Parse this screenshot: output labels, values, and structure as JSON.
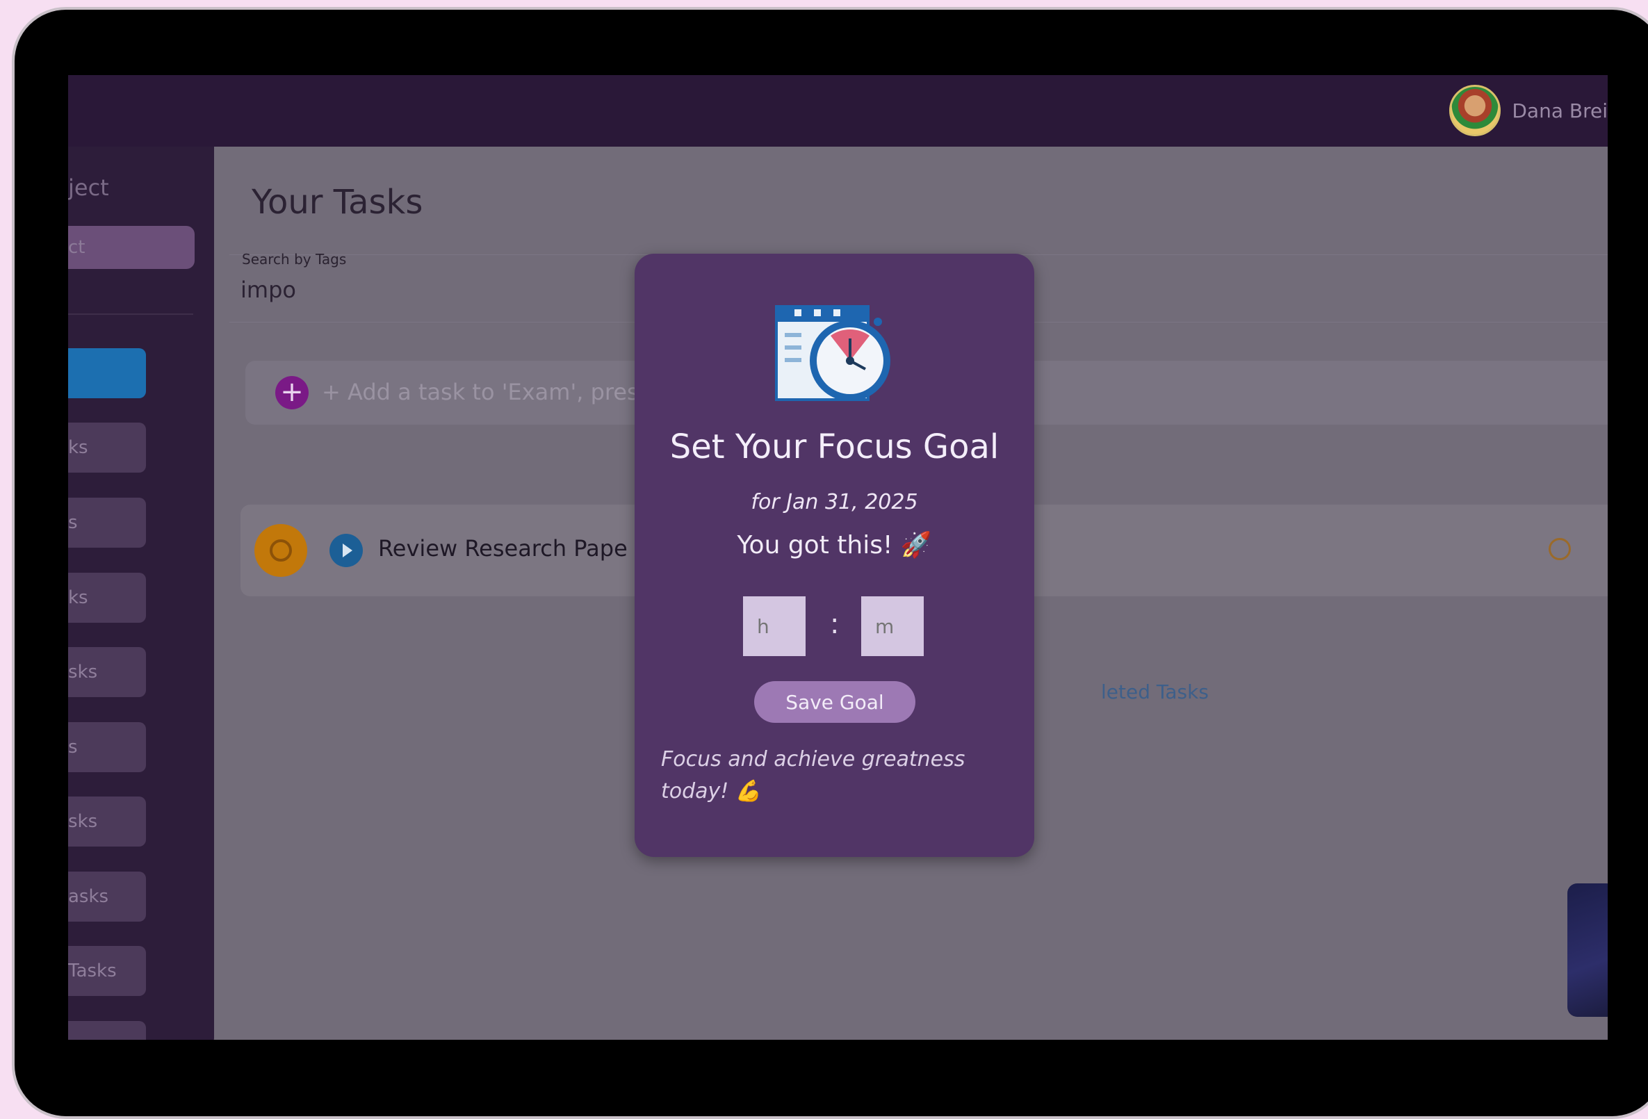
{
  "topbar": {
    "user_name": "Dana Brei",
    "avatar_icon": "user-avatar"
  },
  "sidebar": {
    "title": "ject",
    "project_button": "ct",
    "items": [
      {
        "label": ""
      },
      {
        "label": "ks"
      },
      {
        "label": "s"
      },
      {
        "label": "ks"
      },
      {
        "label": "sks"
      },
      {
        "label": "s"
      },
      {
        "label": "sks"
      },
      {
        "label": "asks"
      },
      {
        "label": "Tasks"
      },
      {
        "label": ""
      }
    ]
  },
  "main": {
    "page_title": "Your Tasks",
    "search": {
      "label": "Search by Tags",
      "value": "impo"
    },
    "add_task": {
      "icon": "+",
      "placeholder": "+ Add a task to 'Exam', pres"
    },
    "tasks": [
      {
        "title": "Review Research Pape"
      }
    ],
    "completed_link": "leted Tasks"
  },
  "modal": {
    "title": "Set Your Focus Goal",
    "date": "for Jan 31, 2025",
    "cheer": "You got this! 🚀",
    "hours_placeholder": "h",
    "minutes_placeholder": "m",
    "separator": ":",
    "save_label": "Save Goal",
    "message": "Focus and achieve greatness today! 💪"
  },
  "colors": {
    "modal_bg": "#513566",
    "topbar_bg": "#2a1838",
    "sidebar_bg": "#2d1d3a",
    "active_item": "#1c6fb0",
    "save_button": "#9d79b4"
  }
}
